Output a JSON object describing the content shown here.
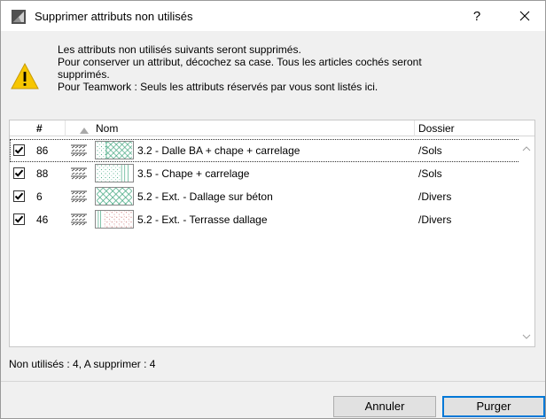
{
  "window": {
    "title": "Supprimer attributs non utilisés",
    "help_label": "?"
  },
  "message": {
    "line1": "Les attributs non utilisés suivants seront supprimés.",
    "line2": "Pour conserver un attribut, décochez sa case. Tous les articles cochés seront",
    "line3": "supprimés.",
    "line4": "Pour Teamwork : Seuls les attributs réservés par vous sont listés ici."
  },
  "table": {
    "columns": {
      "num": "#",
      "name": "Nom",
      "folder": "Dossier"
    },
    "rows": [
      {
        "checked": true,
        "num": "86",
        "name": "3.2 - Dalle BA + chape + carrelage",
        "folder": "/Sols",
        "pattern": "tile-cross"
      },
      {
        "checked": true,
        "num": "88",
        "name": "3.5 - Chape + carrelage",
        "folder": "/Sols",
        "pattern": "dots"
      },
      {
        "checked": true,
        "num": "6",
        "name": "5.2 - Ext. - Dallage sur béton",
        "folder": "/Divers",
        "pattern": "cross"
      },
      {
        "checked": true,
        "num": "46",
        "name": "5.2 - Ext. - Terrasse dallage",
        "folder": "/Divers",
        "pattern": "sand"
      }
    ]
  },
  "status": "Non utilisés : 4, A supprimer : 4",
  "buttons": {
    "cancel": "Annuler",
    "purge": "Purger"
  },
  "colors": {
    "accent": "#0078d7",
    "warning": "#f7c600",
    "swatch_green": "#3aa37a"
  }
}
